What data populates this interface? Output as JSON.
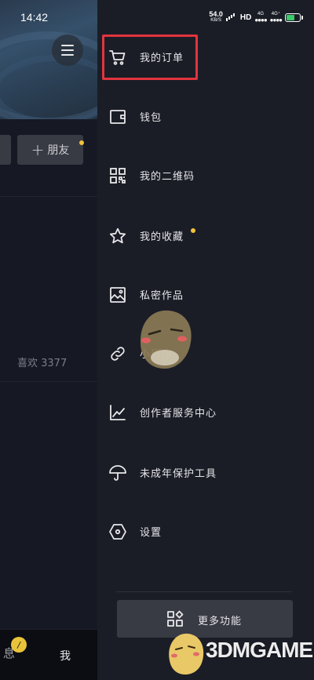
{
  "status_bar": {
    "time": "14:42",
    "net_speed": "54.0",
    "net_speed_unit": "KB/S",
    "hd": "HD",
    "network_1": "4G",
    "network_2": "4G⁺"
  },
  "background_page": {
    "add_friend_label": "朋友",
    "likes_label": "喜欢 3377",
    "tab_message": "息",
    "tab_message_badge": "/",
    "tab_me": "我"
  },
  "drawer": {
    "items": [
      {
        "label": "我的订单",
        "icon": "cart-icon"
      },
      {
        "label": "钱包",
        "icon": "wallet-icon"
      },
      {
        "label": "我的二维码",
        "icon": "qr-code-icon"
      },
      {
        "label": "我的收藏",
        "icon": "star-icon"
      },
      {
        "label": "私密作品",
        "icon": "image-icon"
      },
      {
        "label": "小程序",
        "icon": "link-icon"
      },
      {
        "label": "创作者服务中心",
        "icon": "trend-chart-icon"
      },
      {
        "label": "未成年保护工具",
        "icon": "umbrella-icon"
      },
      {
        "label": "设置",
        "icon": "hexagon-settings-icon"
      }
    ],
    "more_button": "更多功能"
  },
  "watermark": {
    "text": "3DMGAME"
  },
  "colors": {
    "drawer_bg": "#1b1d26",
    "highlight": "#e3343d",
    "notify_dot": "#f3c13b"
  }
}
